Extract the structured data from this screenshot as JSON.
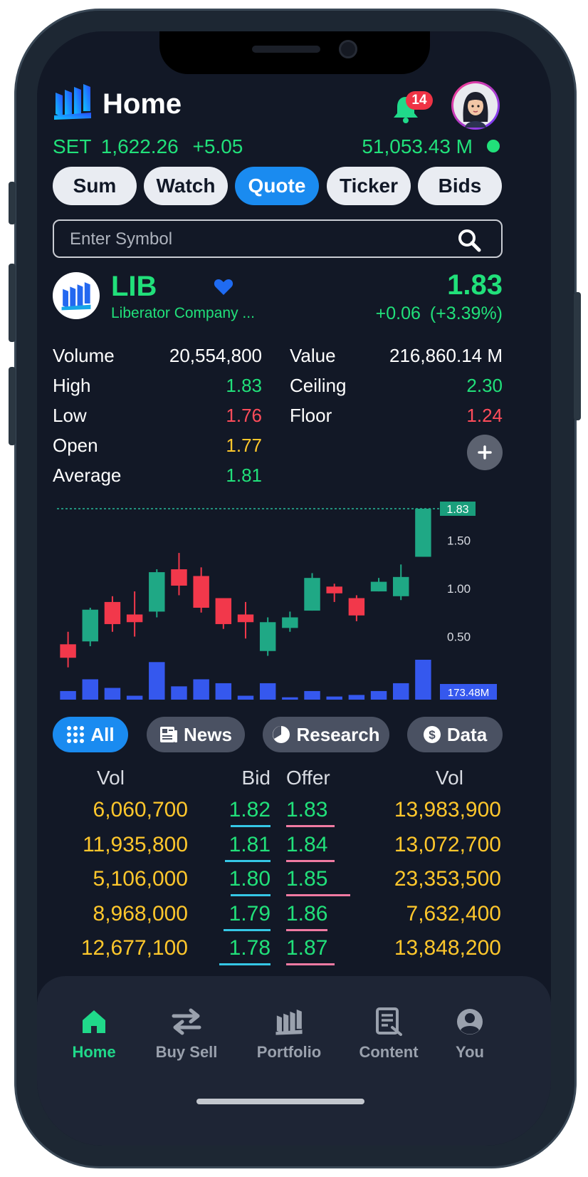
{
  "header": {
    "title": "Home",
    "notification_count": "14"
  },
  "market": {
    "index_name": "SET",
    "index_value": "1,622.26",
    "index_change": "+5.05",
    "market_value": "51,053.43 M",
    "status_color": "#21e07a"
  },
  "tabs": [
    "Sum",
    "Watch",
    "Quote",
    "Ticker",
    "Bids"
  ],
  "active_tab": "Quote",
  "search": {
    "placeholder": "Enter Symbol"
  },
  "quote": {
    "symbol": "LIB",
    "company": "Liberator Company ...",
    "price": "1.83",
    "change": "+0.06",
    "change_pct": "(+3.39%)"
  },
  "stats_left": [
    {
      "label": "Volume",
      "value": "20,554,800",
      "tone": "white"
    },
    {
      "label": "High",
      "value": "1.83",
      "tone": "green"
    },
    {
      "label": "Low",
      "value": "1.76",
      "tone": "red"
    },
    {
      "label": "Open",
      "value": "1.77",
      "tone": "yellow"
    },
    {
      "label": "Average",
      "value": "1.81",
      "tone": "green"
    }
  ],
  "stats_right": [
    {
      "label": "Value",
      "value": "216,860.14 M",
      "tone": "white"
    },
    {
      "label": "Ceiling",
      "value": "2.30",
      "tone": "green"
    },
    {
      "label": "Floor",
      "value": "1.24",
      "tone": "red"
    }
  ],
  "chart_data": {
    "type": "candlestick",
    "ylim": [
      0.2,
      1.83
    ],
    "y_ticks": [
      "1.50",
      "1.00",
      "0.50"
    ],
    "last_price_label": "1.83",
    "volume_label": "173.48M",
    "candles": [
      {
        "open": 0.42,
        "close": 0.28,
        "high": 0.55,
        "low": 0.18
      },
      {
        "open": 0.45,
        "close": 0.78,
        "high": 0.8,
        "low": 0.4
      },
      {
        "open": 0.86,
        "close": 0.63,
        "high": 0.92,
        "low": 0.55
      },
      {
        "open": 0.73,
        "close": 0.65,
        "high": 0.97,
        "low": 0.5
      },
      {
        "open": 0.76,
        "close": 1.17,
        "high": 1.2,
        "low": 0.7
      },
      {
        "open": 1.2,
        "close": 1.03,
        "high": 1.37,
        "low": 0.93
      },
      {
        "open": 1.13,
        "close": 0.8,
        "high": 1.22,
        "low": 0.75
      },
      {
        "open": 0.9,
        "close": 0.63,
        "high": 0.9,
        "low": 0.58
      },
      {
        "open": 0.73,
        "close": 0.65,
        "high": 0.86,
        "low": 0.48
      },
      {
        "open": 0.35,
        "close": 0.65,
        "high": 0.7,
        "low": 0.3
      },
      {
        "open": 0.59,
        "close": 0.7,
        "high": 0.76,
        "low": 0.55
      },
      {
        "open": 0.77,
        "close": 1.11,
        "high": 1.16,
        "low": 0.77
      },
      {
        "open": 1.02,
        "close": 0.95,
        "high": 1.05,
        "low": 0.86
      },
      {
        "open": 0.9,
        "close": 0.72,
        "high": 0.93,
        "low": 0.66
      },
      {
        "open": 0.97,
        "close": 1.07,
        "high": 1.11,
        "low": 0.97
      },
      {
        "open": 0.92,
        "close": 1.12,
        "high": 1.25,
        "low": 0.88
      },
      {
        "open": 1.33,
        "close": 1.83,
        "high": 1.83,
        "low": 1.33
      }
    ],
    "volumes": [
      11,
      26,
      15,
      5,
      48,
      17,
      26,
      21,
      5,
      21,
      3,
      11,
      4,
      6,
      11,
      21,
      51
    ],
    "up_color": "#1fa885",
    "down_color": "#f2384b",
    "volume_color": "#3558ee"
  },
  "filters": [
    {
      "label": "All",
      "icon": "grid-icon"
    },
    {
      "label": "News",
      "icon": "news-icon"
    },
    {
      "label": "Research",
      "icon": "research-icon"
    },
    {
      "label": "Data",
      "icon": "dollar-icon"
    }
  ],
  "orderbook": {
    "headers": {
      "bid_vol": "Vol",
      "bid": "Bid",
      "offer": "Offer",
      "offer_vol": "Vol"
    },
    "rows": [
      {
        "bid_vol": "6,060,700",
        "bid": "1.82",
        "offer": "1.83",
        "offer_vol": "13,983,900"
      },
      {
        "bid_vol": "11,935,800",
        "bid": "1.81",
        "offer": "1.84",
        "offer_vol": "13,072,700"
      },
      {
        "bid_vol": "5,106,000",
        "bid": "1.80",
        "offer": "1.85",
        "offer_vol": "23,353,500"
      },
      {
        "bid_vol": "8,968,000",
        "bid": "1.79",
        "offer": "1.86",
        "offer_vol": "7,632,400"
      },
      {
        "bid_vol": "12,677,100",
        "bid": "1.78",
        "offer": "1.87",
        "offer_vol": "13,848,200"
      }
    ]
  },
  "bottom_nav": [
    {
      "label": "Home",
      "icon": "home-icon"
    },
    {
      "label": "Buy Sell",
      "icon": "transfer-arrows-icon"
    },
    {
      "label": "Portfolio",
      "icon": "portfolio-icon"
    },
    {
      "label": "Content",
      "icon": "content-icon"
    },
    {
      "label": "You",
      "icon": "user-icon"
    }
  ],
  "active_nav": "Home"
}
